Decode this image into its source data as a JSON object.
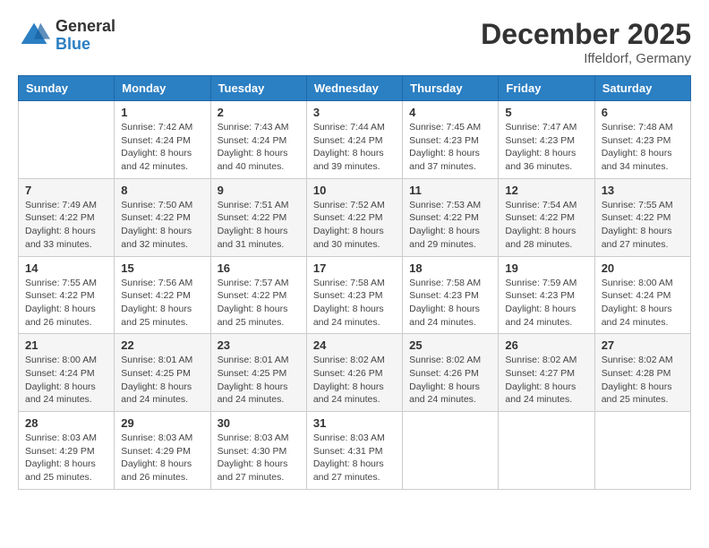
{
  "logo": {
    "general": "General",
    "blue": "Blue"
  },
  "title": "December 2025",
  "location": "Iffeldorf, Germany",
  "days_of_week": [
    "Sunday",
    "Monday",
    "Tuesday",
    "Wednesday",
    "Thursday",
    "Friday",
    "Saturday"
  ],
  "weeks": [
    [
      {
        "day": "",
        "info": ""
      },
      {
        "day": "1",
        "info": "Sunrise: 7:42 AM\nSunset: 4:24 PM\nDaylight: 8 hours\nand 42 minutes."
      },
      {
        "day": "2",
        "info": "Sunrise: 7:43 AM\nSunset: 4:24 PM\nDaylight: 8 hours\nand 40 minutes."
      },
      {
        "day": "3",
        "info": "Sunrise: 7:44 AM\nSunset: 4:24 PM\nDaylight: 8 hours\nand 39 minutes."
      },
      {
        "day": "4",
        "info": "Sunrise: 7:45 AM\nSunset: 4:23 PM\nDaylight: 8 hours\nand 37 minutes."
      },
      {
        "day": "5",
        "info": "Sunrise: 7:47 AM\nSunset: 4:23 PM\nDaylight: 8 hours\nand 36 minutes."
      },
      {
        "day": "6",
        "info": "Sunrise: 7:48 AM\nSunset: 4:23 PM\nDaylight: 8 hours\nand 34 minutes."
      }
    ],
    [
      {
        "day": "7",
        "info": "Sunrise: 7:49 AM\nSunset: 4:22 PM\nDaylight: 8 hours\nand 33 minutes."
      },
      {
        "day": "8",
        "info": "Sunrise: 7:50 AM\nSunset: 4:22 PM\nDaylight: 8 hours\nand 32 minutes."
      },
      {
        "day": "9",
        "info": "Sunrise: 7:51 AM\nSunset: 4:22 PM\nDaylight: 8 hours\nand 31 minutes."
      },
      {
        "day": "10",
        "info": "Sunrise: 7:52 AM\nSunset: 4:22 PM\nDaylight: 8 hours\nand 30 minutes."
      },
      {
        "day": "11",
        "info": "Sunrise: 7:53 AM\nSunset: 4:22 PM\nDaylight: 8 hours\nand 29 minutes."
      },
      {
        "day": "12",
        "info": "Sunrise: 7:54 AM\nSunset: 4:22 PM\nDaylight: 8 hours\nand 28 minutes."
      },
      {
        "day": "13",
        "info": "Sunrise: 7:55 AM\nSunset: 4:22 PM\nDaylight: 8 hours\nand 27 minutes."
      }
    ],
    [
      {
        "day": "14",
        "info": "Sunrise: 7:55 AM\nSunset: 4:22 PM\nDaylight: 8 hours\nand 26 minutes."
      },
      {
        "day": "15",
        "info": "Sunrise: 7:56 AM\nSunset: 4:22 PM\nDaylight: 8 hours\nand 25 minutes."
      },
      {
        "day": "16",
        "info": "Sunrise: 7:57 AM\nSunset: 4:22 PM\nDaylight: 8 hours\nand 25 minutes."
      },
      {
        "day": "17",
        "info": "Sunrise: 7:58 AM\nSunset: 4:23 PM\nDaylight: 8 hours\nand 24 minutes."
      },
      {
        "day": "18",
        "info": "Sunrise: 7:58 AM\nSunset: 4:23 PM\nDaylight: 8 hours\nand 24 minutes."
      },
      {
        "day": "19",
        "info": "Sunrise: 7:59 AM\nSunset: 4:23 PM\nDaylight: 8 hours\nand 24 minutes."
      },
      {
        "day": "20",
        "info": "Sunrise: 8:00 AM\nSunset: 4:24 PM\nDaylight: 8 hours\nand 24 minutes."
      }
    ],
    [
      {
        "day": "21",
        "info": "Sunrise: 8:00 AM\nSunset: 4:24 PM\nDaylight: 8 hours\nand 24 minutes."
      },
      {
        "day": "22",
        "info": "Sunrise: 8:01 AM\nSunset: 4:25 PM\nDaylight: 8 hours\nand 24 minutes."
      },
      {
        "day": "23",
        "info": "Sunrise: 8:01 AM\nSunset: 4:25 PM\nDaylight: 8 hours\nand 24 minutes."
      },
      {
        "day": "24",
        "info": "Sunrise: 8:02 AM\nSunset: 4:26 PM\nDaylight: 8 hours\nand 24 minutes."
      },
      {
        "day": "25",
        "info": "Sunrise: 8:02 AM\nSunset: 4:26 PM\nDaylight: 8 hours\nand 24 minutes."
      },
      {
        "day": "26",
        "info": "Sunrise: 8:02 AM\nSunset: 4:27 PM\nDaylight: 8 hours\nand 24 minutes."
      },
      {
        "day": "27",
        "info": "Sunrise: 8:02 AM\nSunset: 4:28 PM\nDaylight: 8 hours\nand 25 minutes."
      }
    ],
    [
      {
        "day": "28",
        "info": "Sunrise: 8:03 AM\nSunset: 4:29 PM\nDaylight: 8 hours\nand 25 minutes."
      },
      {
        "day": "29",
        "info": "Sunrise: 8:03 AM\nSunset: 4:29 PM\nDaylight: 8 hours\nand 26 minutes."
      },
      {
        "day": "30",
        "info": "Sunrise: 8:03 AM\nSunset: 4:30 PM\nDaylight: 8 hours\nand 27 minutes."
      },
      {
        "day": "31",
        "info": "Sunrise: 8:03 AM\nSunset: 4:31 PM\nDaylight: 8 hours\nand 27 minutes."
      },
      {
        "day": "",
        "info": ""
      },
      {
        "day": "",
        "info": ""
      },
      {
        "day": "",
        "info": ""
      }
    ]
  ]
}
